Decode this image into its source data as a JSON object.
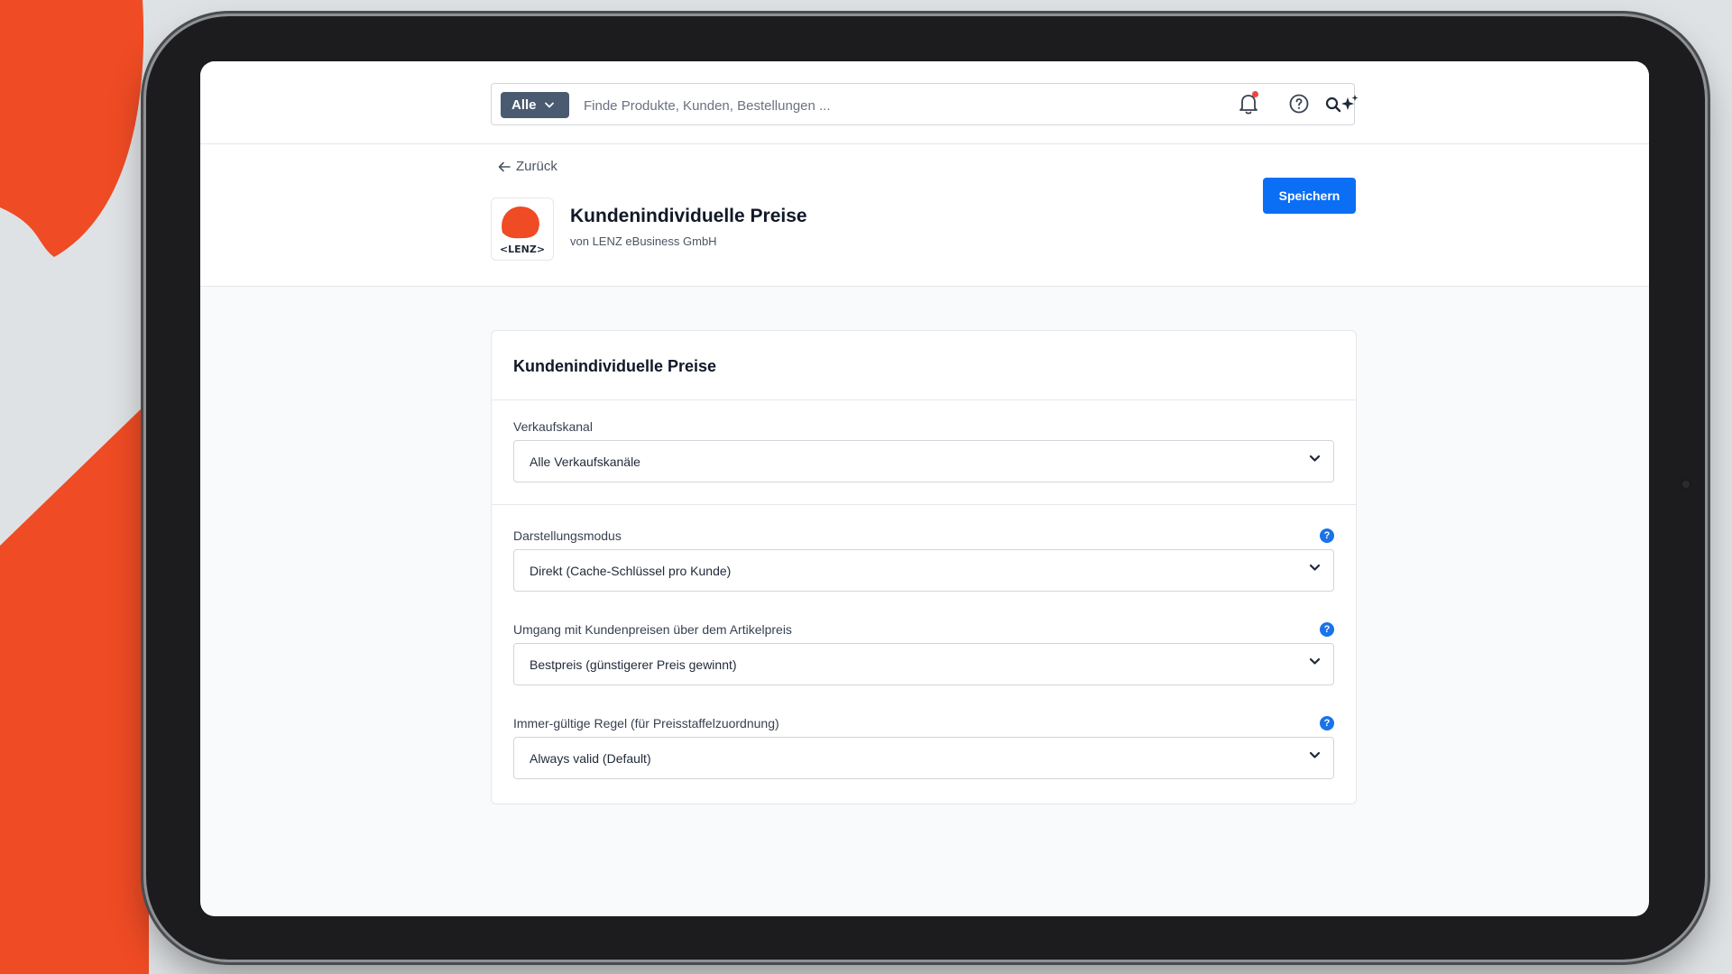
{
  "topbar": {
    "search_scope": "Alle",
    "search_placeholder": "Finde Produkte, Kunden, Bestellungen ...",
    "icons": [
      "search-icon",
      "bell-icon",
      "help-circle-icon",
      "sparkle-icon"
    ]
  },
  "header": {
    "back_label": "Zurück",
    "app_title": "Kundenindividuelle Preise",
    "app_vendor": "von LENZ eBusiness GmbH",
    "logo_text": "<LENZ>",
    "save_label": "Speichern"
  },
  "card": {
    "title": "Kundenindividuelle Preise",
    "fields": [
      {
        "label": "Verkaufskanal",
        "value": "Alle Verkaufskanäle",
        "has_help": false
      },
      {
        "label": "Darstellungsmodus",
        "value": "Direkt (Cache-Schlüssel pro Kunde)",
        "has_help": true
      },
      {
        "label": "Umgang mit Kundenpreisen über dem Artikelpreis",
        "value": "Bestpreis (günstigerer Preis gewinnt)",
        "has_help": true
      },
      {
        "label": "Immer-gültige Regel (für Preisstaffelzuordnung)",
        "value": "Always valid (Default)",
        "has_help": true
      }
    ],
    "help_glyph": "?"
  },
  "colors": {
    "accent": "#0b6ff5",
    "brand_orange": "#ef4b24",
    "scope_chip": "#4a5a70",
    "notification_dot": "#ef4444"
  }
}
